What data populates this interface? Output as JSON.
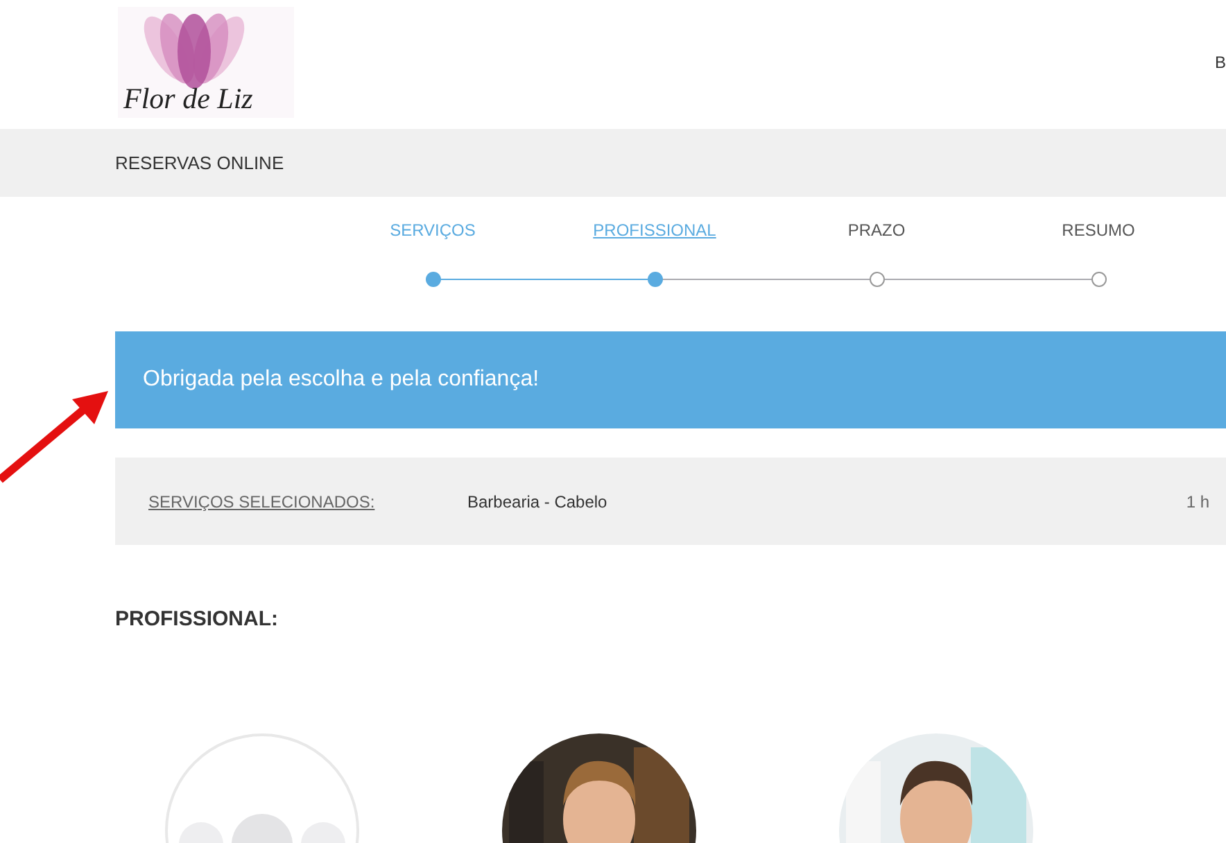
{
  "logo": {
    "text": "Flor de Liz"
  },
  "header": {
    "cut_link": "B"
  },
  "nav": {
    "title": "RESERVAS ONLINE"
  },
  "steps": [
    {
      "label": "SERVIÇOS",
      "done": true,
      "selected": false
    },
    {
      "label": "PROFISSIONAL",
      "done": true,
      "selected": true
    },
    {
      "label": "PRAZO",
      "done": false,
      "selected": false
    },
    {
      "label": "RESUMO",
      "done": false,
      "selected": false
    }
  ],
  "banner": {
    "text": "Obrigada pela escolha e pela confiança!"
  },
  "selected_services": {
    "label": "SERVIÇOS SELECIONADOS:",
    "service": "Barbearia - Cabelo",
    "duration": "1 h"
  },
  "professional": {
    "heading": "PROFISSIONAL:",
    "options": [
      {
        "kind": "any"
      },
      {
        "kind": "picture"
      },
      {
        "kind": "picture"
      }
    ]
  }
}
